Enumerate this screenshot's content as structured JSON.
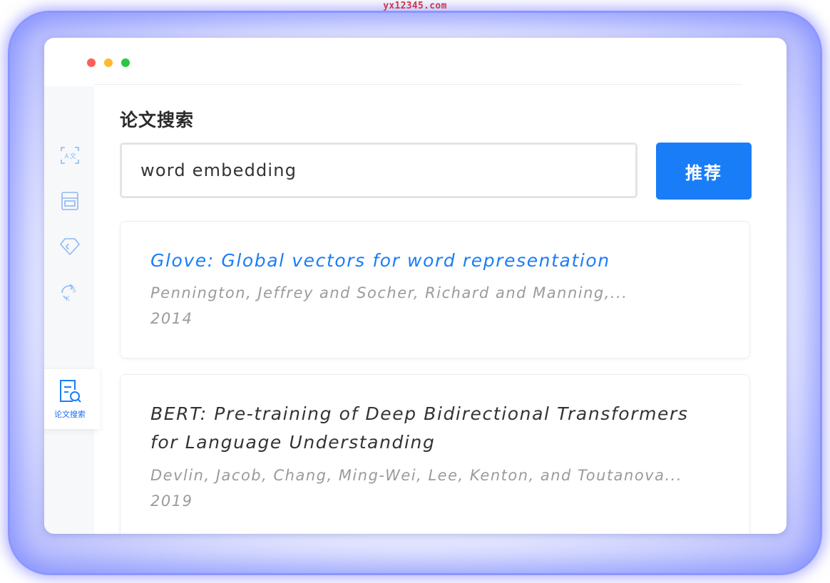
{
  "watermark": "yx12345.com",
  "sidebar": {
    "items": [
      {
        "icon": "translate-icon"
      },
      {
        "icon": "document-icon"
      },
      {
        "icon": "code-tag-icon"
      },
      {
        "icon": "sync-icon"
      },
      {
        "icon": "paper-search-icon",
        "label": "论文搜索",
        "active": true
      }
    ]
  },
  "page": {
    "title": "论文搜索"
  },
  "search": {
    "value": "word embedding",
    "button_label": "推荐"
  },
  "results": [
    {
      "title": "Glove: Global vectors for word representation",
      "authors": "Pennington, Jeffrey and Socher, Richard and Manning,...",
      "year": "2014"
    },
    {
      "title_line1": "BERT: Pre-training of Deep Bidirectional Transformers",
      "title_line2": "for Language Understanding",
      "authors": "Devlin, Jacob, Chang, Ming-Wei, Lee, Kenton, and Toutanova...",
      "year": "2019"
    }
  ],
  "colors": {
    "accent": "#1a7df8",
    "meta_text": "#9b9b9b",
    "traffic_red": "#fe5f57",
    "traffic_yellow": "#febb2e",
    "traffic_green": "#29c840"
  }
}
